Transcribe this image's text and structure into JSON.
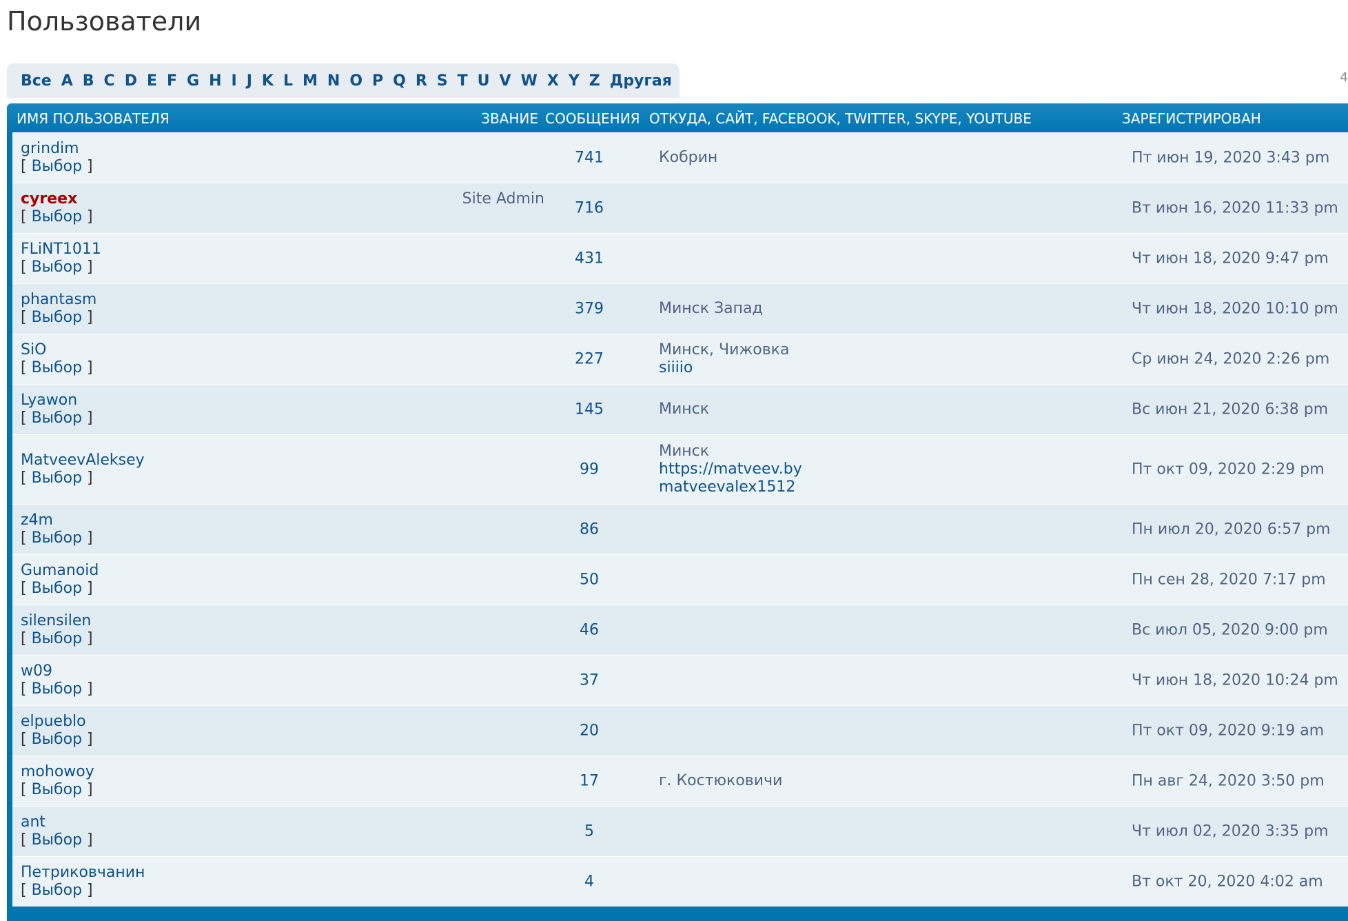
{
  "page": {
    "title": "Пользователи"
  },
  "alphabet": [
    "Все",
    "A",
    "B",
    "C",
    "D",
    "E",
    "F",
    "G",
    "H",
    "I",
    "J",
    "K",
    "L",
    "M",
    "N",
    "O",
    "P",
    "Q",
    "R",
    "S",
    "T",
    "U",
    "V",
    "W",
    "X",
    "Y",
    "Z",
    "Другая"
  ],
  "edge_mark": "4",
  "table": {
    "headers": {
      "name": "Имя пользователя",
      "rank": "Звание",
      "posts": "Сообщения",
      "from": "Откуда, Сайт, Facebook, Twitter, Skype, YouTube",
      "joined": "Зарегистрирован"
    },
    "select_label": "Выбор",
    "colors": {
      "header": "#0076b1",
      "row_odd": "#ecf3f7",
      "row_even": "#e1ebf2",
      "link": "#105289",
      "admin": "#aa0000"
    },
    "rows": [
      {
        "username": "grindim",
        "rank": "",
        "posts": "741",
        "from": "Кобрин",
        "website": "",
        "skype": "",
        "joined": "Пт июн 19, 2020 3:43 pm"
      },
      {
        "username": "cyreex",
        "rank": "Site Admin",
        "posts": "716",
        "from": "",
        "website": "",
        "skype": "",
        "joined": "Вт июн 16, 2020 11:33 pm",
        "admin": true
      },
      {
        "username": "FLiNT1011",
        "rank": "",
        "posts": "431",
        "from": "",
        "website": "",
        "skype": "",
        "joined": "Чт июн 18, 2020 9:47 pm"
      },
      {
        "username": "phantasm",
        "rank": "",
        "posts": "379",
        "from": "Минск Запад",
        "website": "",
        "skype": "",
        "joined": "Чт июн 18, 2020 10:10 pm"
      },
      {
        "username": "SiO",
        "rank": "",
        "posts": "227",
        "from": "Минск, Чижовка",
        "website": "",
        "skype": "siiiio",
        "joined": "Ср июн 24, 2020 2:26 pm"
      },
      {
        "username": "Lyawon",
        "rank": "",
        "posts": "145",
        "from": "Минск",
        "website": "",
        "skype": "",
        "joined": "Вс июн 21, 2020 6:38 pm"
      },
      {
        "username": "MatveevAleksey",
        "rank": "",
        "posts": "99",
        "from": "Минск",
        "website": "https://matveev.by",
        "skype": "matveevalex1512",
        "joined": "Пт окт 09, 2020 2:29 pm"
      },
      {
        "username": "z4m",
        "rank": "",
        "posts": "86",
        "from": "",
        "website": "",
        "skype": "",
        "joined": "Пн июл 20, 2020 6:57 pm"
      },
      {
        "username": "Gumanoid",
        "rank": "",
        "posts": "50",
        "from": "",
        "website": "",
        "skype": "",
        "joined": "Пн сен 28, 2020 7:17 pm"
      },
      {
        "username": "silensilen",
        "rank": "",
        "posts": "46",
        "from": "",
        "website": "",
        "skype": "",
        "joined": "Вс июл 05, 2020 9:00 pm"
      },
      {
        "username": "w09",
        "rank": "",
        "posts": "37",
        "from": "",
        "website": "",
        "skype": "",
        "joined": "Чт июн 18, 2020 10:24 pm"
      },
      {
        "username": "elpueblo",
        "rank": "",
        "posts": "20",
        "from": "",
        "website": "",
        "skype": "",
        "joined": "Пт окт 09, 2020 9:19 am"
      },
      {
        "username": "mohowoy",
        "rank": "",
        "posts": "17",
        "from": "г. Костюковичи",
        "website": "",
        "skype": "",
        "joined": "Пн авг 24, 2020 3:50 pm"
      },
      {
        "username": "ant",
        "rank": "",
        "posts": "5",
        "from": "",
        "website": "",
        "skype": "",
        "joined": "Чт июл 02, 2020 3:35 pm"
      },
      {
        "username": "Петриковчанин",
        "rank": "",
        "posts": "4",
        "from": "",
        "website": "",
        "skype": "",
        "joined": "Вт окт 20, 2020 4:02 am"
      }
    ]
  }
}
